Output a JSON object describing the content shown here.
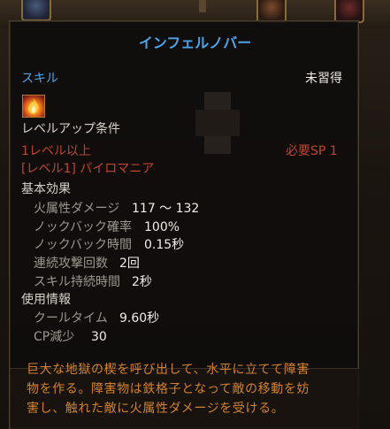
{
  "skill": {
    "name": "インフェルノバー",
    "type_label": "スキル",
    "status": "未習得",
    "icon": "flame-icon"
  },
  "requirements": {
    "title": "レベルアップ条件",
    "level": "1レベル以上",
    "sp": "必要SP 1",
    "prerequisite": "[レベル1] パイロマニア"
  },
  "basic_effects": {
    "title": "基本効果",
    "rows": [
      {
        "label": "火属性ダメージ",
        "value": "117 ～ 132"
      },
      {
        "label": "ノックバック確率",
        "value": "100%"
      },
      {
        "label": "ノックバック時間",
        "value": "0.15秒"
      },
      {
        "label": "連続攻撃回数",
        "value": "2回"
      },
      {
        "label": "スキル持続時間",
        "value": "2秒"
      }
    ]
  },
  "usage_info": {
    "title": "使用情報",
    "rows": [
      {
        "label": "クールタイム",
        "value": "9.60秒"
      },
      {
        "label": "CP減少",
        "value": "30"
      }
    ]
  },
  "description": {
    "lines": [
      "巨大な地獄の楔を呼び出して、水平に立てて障害",
      "物を作る。障害物は鉄格子となって敵の移動を妨",
      "害し、触れた敵に火属性ダメージを受ける。"
    ]
  },
  "colors": {
    "title_blue": "#4fa3e8",
    "requirement_red": "#c0452e",
    "description_orange": "#d2822e",
    "label_gray": "#9c9890",
    "value_white": "#f0ece6"
  }
}
